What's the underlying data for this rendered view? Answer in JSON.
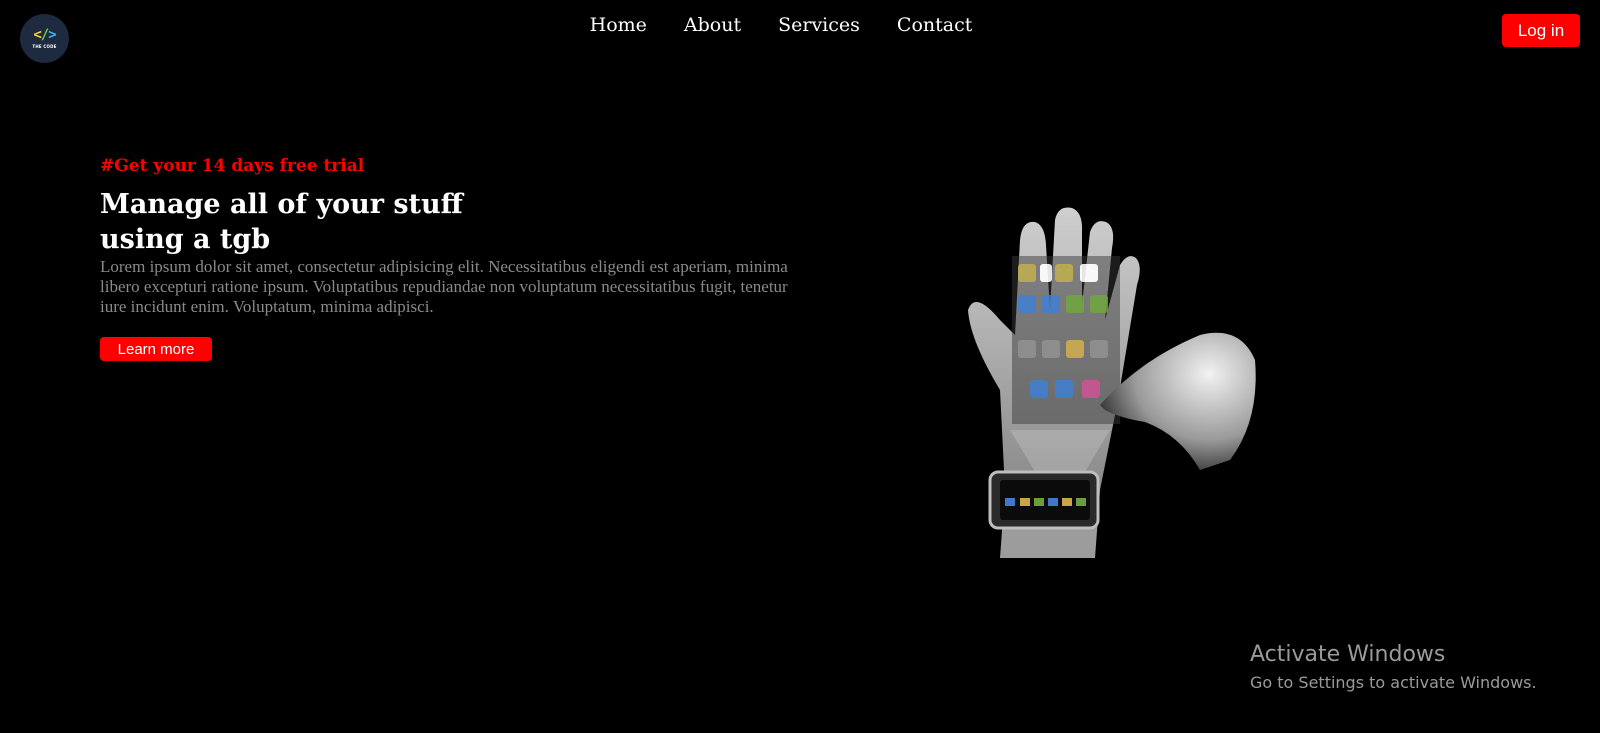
{
  "logo": {
    "symbol_left": "<",
    "symbol_slash": "/",
    "symbol_right": ">",
    "text": "THE CODE"
  },
  "nav": {
    "items": [
      "Home",
      "About",
      "Services",
      "Contact"
    ]
  },
  "header": {
    "login_label": "Log in"
  },
  "hero": {
    "tag": "#Get your 14 days free trial",
    "headline": "Manage all of your stuff using a tgb",
    "body": "Lorem ipsum dolor sit amet, consectetur adipisicing elit. Necessitatibus eligendi est aperiam, minima libero excepturi ratione ipsum. Voluptatibus repudiandae non voluptatum necessitatibus fugit, tenetur iure incidunt enim. Voluptatum, minima adipisci.",
    "cta_label": "Learn more"
  },
  "watermark": {
    "title": "Activate Windows",
    "subtitle": "Go to Settings to activate Windows."
  },
  "colors": {
    "accent": "#ff0000",
    "background": "#000000",
    "logo_bg": "#1d2a40"
  }
}
